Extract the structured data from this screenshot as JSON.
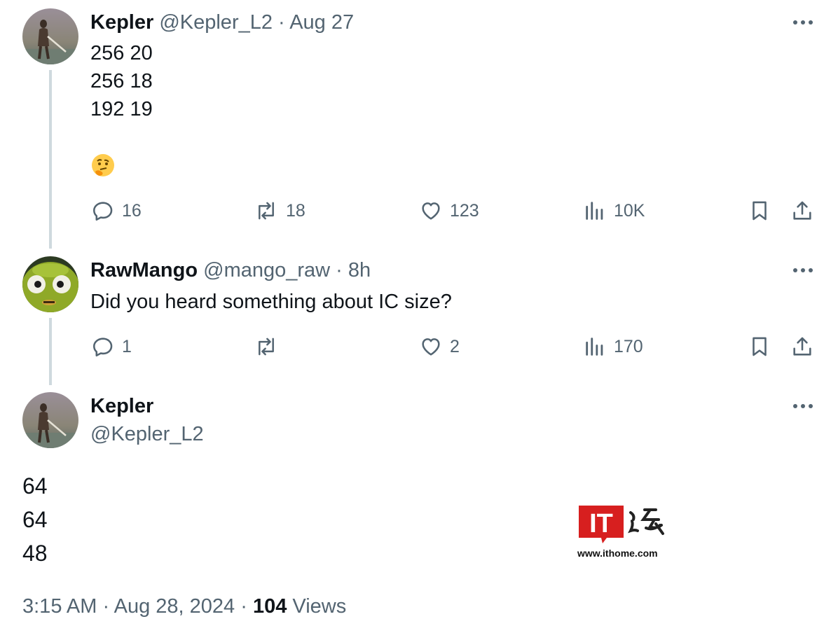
{
  "tweets": [
    {
      "name": "Kepler",
      "handle": "@Kepler_L2",
      "separator": "·",
      "time": "Aug 27",
      "lines": [
        "256 20",
        "256 18",
        "192 19"
      ],
      "emoji": "thinking-face",
      "replies": "16",
      "reposts": "18",
      "likes": "123",
      "views": "10K"
    },
    {
      "name": "RawMango",
      "handle": "@mango_raw",
      "separator": "·",
      "time": "8h",
      "text": "Did you heard something about IC size?",
      "replies": "1",
      "reposts": "",
      "likes": "2",
      "views": "170"
    }
  ],
  "main_tweet": {
    "name": "Kepler",
    "handle": "@Kepler_L2",
    "lines": [
      "64",
      "64",
      "48"
    ],
    "time": "3:15 AM",
    "separator": "·",
    "date": "Aug 28, 2024",
    "views_count": "104",
    "views_label": "Views"
  },
  "watermark": {
    "logo_text": "IT",
    "url": "www.ithome.com"
  },
  "colors": {
    "text_primary": "#0f1419",
    "text_secondary": "#536471",
    "thread_line": "#cfd9de",
    "watermark_red": "#d71f1f"
  }
}
